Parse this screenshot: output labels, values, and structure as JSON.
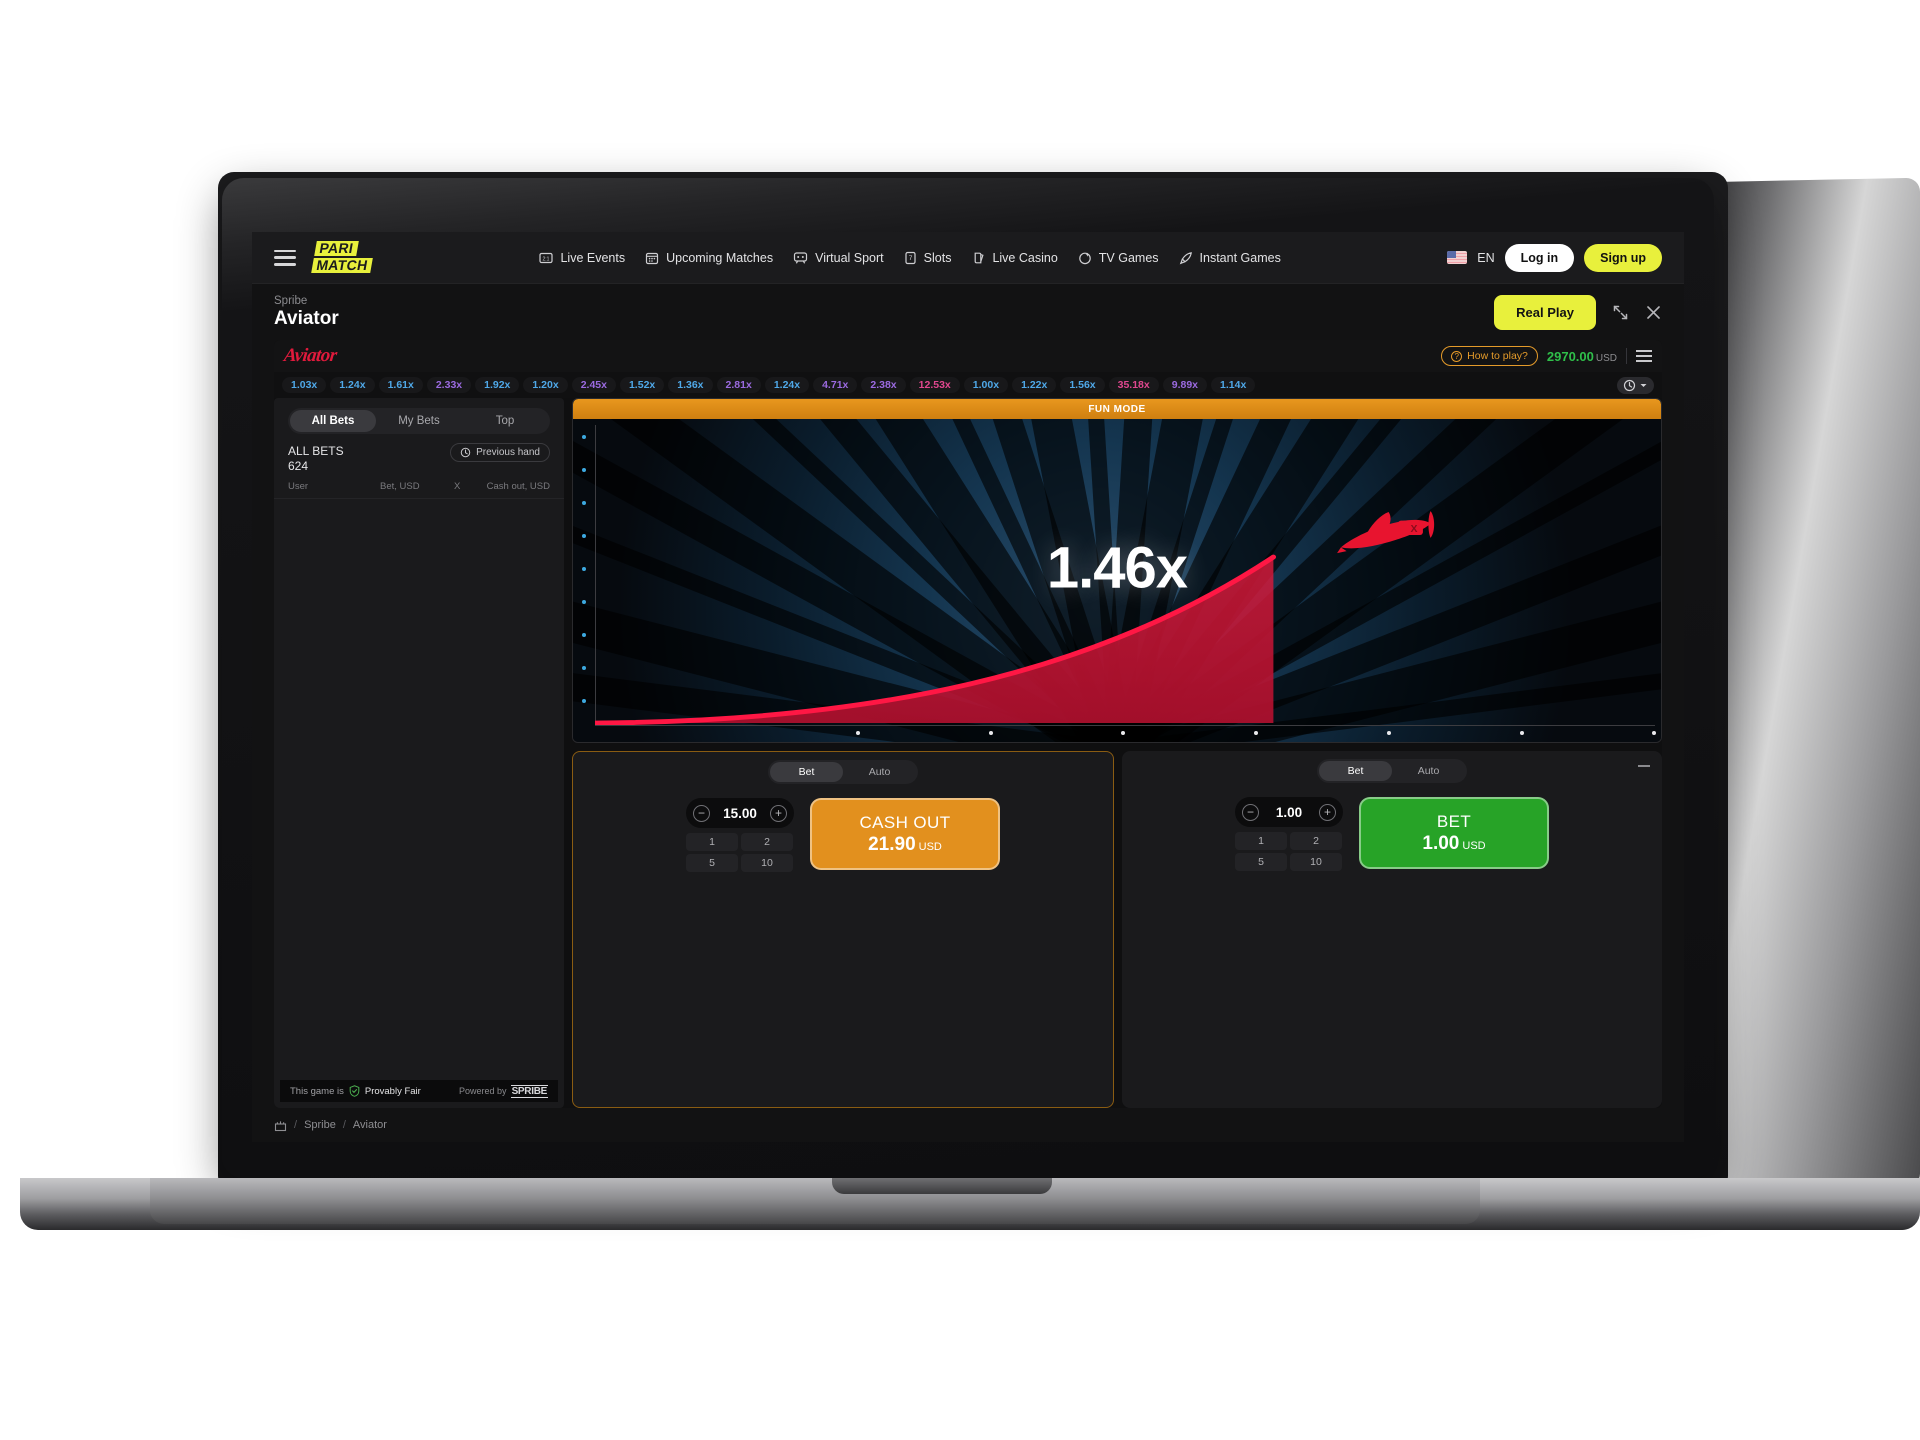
{
  "topnav": {
    "menu_icon": "hamburger-icon",
    "brand_line1": "PARI",
    "brand_line2": "MATCH",
    "items": [
      {
        "label": "Live Events",
        "icon": "score-icon"
      },
      {
        "label": "Upcoming Matches",
        "icon": "calendar-icon"
      },
      {
        "label": "Virtual Sport",
        "icon": "gamepad-icon"
      },
      {
        "label": "Slots",
        "icon": "slot-card-icon"
      },
      {
        "label": "Live Casino",
        "icon": "cards-icon"
      },
      {
        "label": "TV Games",
        "icon": "sparkle-icon"
      },
      {
        "label": "Instant Games",
        "icon": "rocket-icon"
      }
    ],
    "language": "EN",
    "login_label": "Log in",
    "signup_label": "Sign up"
  },
  "gamehead": {
    "provider": "Spribe",
    "title": "Aviator",
    "real_play_label": "Real Play",
    "expand_icon": "expand-icon",
    "close_icon": "close-icon"
  },
  "aviator_bar": {
    "logo_text": "Aviator",
    "how_to_play": "How to play?",
    "balance": "2970.00",
    "currency": "USD",
    "menu_icon": "hamburger-icon"
  },
  "history": {
    "items": [
      {
        "value": "1.03x",
        "color": "#4fa8e8"
      },
      {
        "value": "1.24x",
        "color": "#4fa8e8"
      },
      {
        "value": "1.61x",
        "color": "#4fa8e8"
      },
      {
        "value": "2.33x",
        "color": "#9b6ae0"
      },
      {
        "value": "1.92x",
        "color": "#4fa8e8"
      },
      {
        "value": "1.20x",
        "color": "#4fa8e8"
      },
      {
        "value": "2.45x",
        "color": "#9b6ae0"
      },
      {
        "value": "1.52x",
        "color": "#4fa8e8"
      },
      {
        "value": "1.36x",
        "color": "#4fa8e8"
      },
      {
        "value": "2.81x",
        "color": "#9b6ae0"
      },
      {
        "value": "1.24x",
        "color": "#4fa8e8"
      },
      {
        "value": "4.71x",
        "color": "#9b6ae0"
      },
      {
        "value": "2.38x",
        "color": "#9b6ae0"
      },
      {
        "value": "12.53x",
        "color": "#e0478f"
      },
      {
        "value": "1.00x",
        "color": "#4fa8e8"
      },
      {
        "value": "1.22x",
        "color": "#4fa8e8"
      },
      {
        "value": "1.56x",
        "color": "#4fa8e8"
      },
      {
        "value": "35.18x",
        "color": "#e0478f"
      },
      {
        "value": "9.89x",
        "color": "#9b6ae0"
      },
      {
        "value": "1.14x",
        "color": "#4fa8e8"
      }
    ],
    "history_icon": "clock-history-icon",
    "chevron_icon": "chevron-down-icon"
  },
  "bets_panel": {
    "tabs": [
      {
        "label": "All Bets",
        "active": true
      },
      {
        "label": "My Bets",
        "active": false
      },
      {
        "label": "Top",
        "active": false
      }
    ],
    "all_bets_label": "ALL BETS",
    "all_bets_count": "624",
    "previous_hand_label": "Previous hand",
    "previous_hand_icon": "clock-history-icon",
    "columns": [
      "User",
      "Bet, USD",
      "X",
      "Cash out, USD"
    ],
    "rows": [],
    "footer_prefix": "This game is",
    "footer_fair": "Provably Fair",
    "footer_shield_icon": "shield-check-icon",
    "footer_powered": "Powered by",
    "footer_brand": "SPRIBE"
  },
  "game": {
    "fun_mode_label": "FUN MODE",
    "multiplier": "1.46x"
  },
  "left_bet_panel": {
    "tabs": [
      {
        "label": "Bet",
        "active": true
      },
      {
        "label": "Auto",
        "active": false
      }
    ],
    "amount": "15.00",
    "minus_icon": "minus-circle-icon",
    "plus_icon": "plus-circle-icon",
    "quick_amounts": [
      "1",
      "2",
      "5",
      "10"
    ],
    "action_title": "CASH OUT",
    "action_value": "21.90",
    "action_currency": "USD"
  },
  "right_bet_panel": {
    "tabs": [
      {
        "label": "Bet",
        "active": true
      },
      {
        "label": "Auto",
        "active": false
      }
    ],
    "amount": "1.00",
    "minus_icon": "minus-circle-icon",
    "plus_icon": "plus-circle-icon",
    "quick_amounts": [
      "1",
      "2",
      "5",
      "10"
    ],
    "action_title": "BET",
    "action_value": "1.00",
    "action_currency": "USD",
    "minimize_icon": "minimize-icon"
  },
  "breadcrumb": {
    "home_icon": "casino-icon",
    "sep": "/",
    "items": [
      "Spribe",
      "Aviator"
    ]
  },
  "colors": {
    "brand_yellow": "#e8f03c",
    "aviator_red": "#e01a3c",
    "cash_orange": "#e2901e",
    "bet_green": "#27a327",
    "balance_green": "#2fbf4a"
  }
}
